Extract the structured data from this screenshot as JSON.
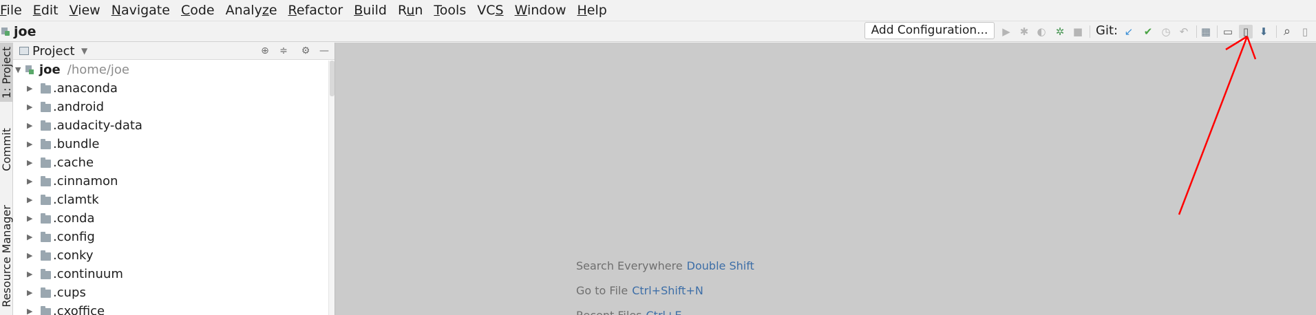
{
  "menu": [
    {
      "pre": "",
      "mn": "F",
      "post": "ile"
    },
    {
      "pre": "",
      "mn": "E",
      "post": "dit"
    },
    {
      "pre": "",
      "mn": "V",
      "post": "iew"
    },
    {
      "pre": "",
      "mn": "N",
      "post": "avigate"
    },
    {
      "pre": "",
      "mn": "C",
      "post": "ode"
    },
    {
      "pre": "Analy",
      "mn": "z",
      "post": "e"
    },
    {
      "pre": "",
      "mn": "R",
      "post": "efactor"
    },
    {
      "pre": "",
      "mn": "B",
      "post": "uild"
    },
    {
      "pre": "R",
      "mn": "u",
      "post": "n"
    },
    {
      "pre": "",
      "mn": "T",
      "post": "ools"
    },
    {
      "pre": "VC",
      "mn": "S",
      "post": ""
    },
    {
      "pre": "",
      "mn": "W",
      "post": "indow"
    },
    {
      "pre": "",
      "mn": "H",
      "post": "elp"
    }
  ],
  "breadcrumb": {
    "label": "joe"
  },
  "toolbar": {
    "add_configuration": "Add Configuration...",
    "git_label": "Git:",
    "icons": {
      "run": "▶",
      "debug": "✱",
      "coverage": "◐",
      "profile": "✲",
      "stop": "■",
      "update": "↙",
      "commit": "✔",
      "history": "◷",
      "rollback": "↶",
      "project_structure": "▦",
      "terminal": "▭",
      "avd_manager": "▯",
      "sdk_manager": "⬇",
      "search": "⌕",
      "account": "▯"
    }
  },
  "sidebar_tabs": [
    "1: Project",
    "Commit",
    "Resource Manager"
  ],
  "project_panel": {
    "title": "Project",
    "root": {
      "name": "joe",
      "path": "/home/joe"
    },
    "items": [
      ".anaconda",
      ".android",
      ".audacity-data",
      ".bundle",
      ".cache",
      ".cinnamon",
      ".clamtk",
      ".conda",
      ".config",
      ".conky",
      ".continuum",
      ".cups",
      ".cxoffice"
    ]
  },
  "editor_hints": [
    {
      "action": "Search Everywhere",
      "key": "Double Shift"
    },
    {
      "action": "Go to File",
      "key": "Ctrl+Shift+N"
    },
    {
      "action": "Recent Files",
      "key": "Ctrl+E"
    }
  ],
  "colors": {
    "accent_blue": "#3d6ea7",
    "annotation_red": "#ff0000",
    "git_update": "#3b8fd6",
    "git_commit": "#49a344"
  }
}
